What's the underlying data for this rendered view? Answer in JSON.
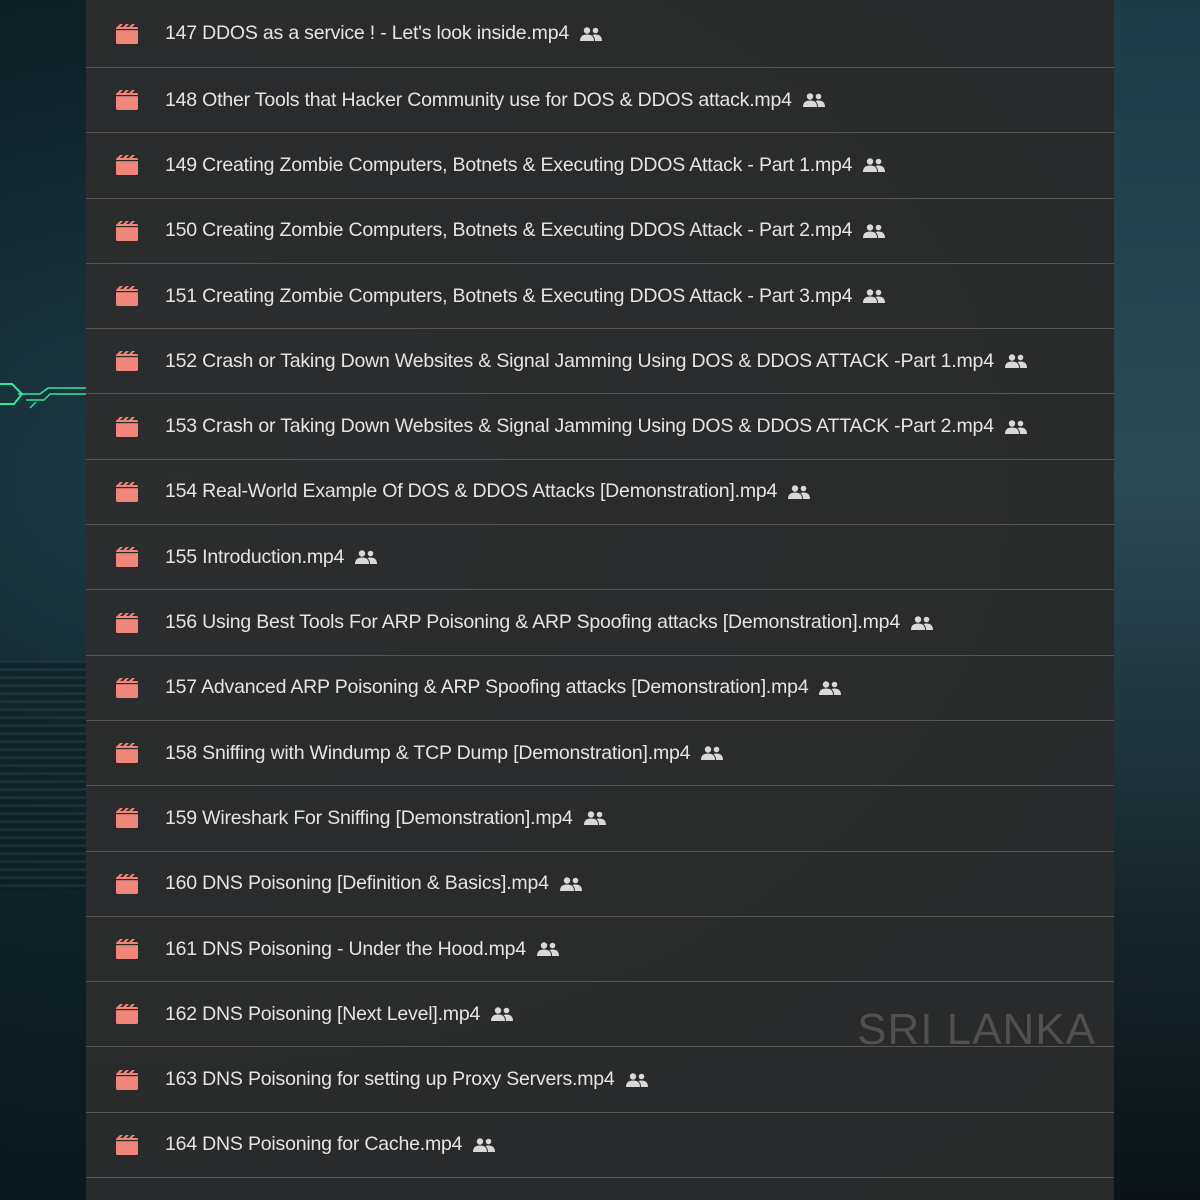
{
  "colors": {
    "row_background": "#2c2c2c",
    "text": "#e4e4e4",
    "file_icon": "#f0857a",
    "shared_icon": "#d8d8d8",
    "divider": "#787878"
  },
  "watermark": "SRI LANKA",
  "files": [
    {
      "name": "147 DDOS as a service ! - Let's look inside.mp4",
      "icon": "video-file-icon",
      "shared": "people-icon"
    },
    {
      "name": "148 Other Tools that Hacker Community use for DOS & DDOS attack.mp4",
      "icon": "video-file-icon",
      "shared": "people-icon"
    },
    {
      "name": "149 Creating Zombie Computers, Botnets & Executing DDOS Attack - Part 1.mp4",
      "icon": "video-file-icon",
      "shared": "people-icon"
    },
    {
      "name": "150 Creating Zombie Computers, Botnets & Executing DDOS Attack - Part 2.mp4",
      "icon": "video-file-icon",
      "shared": "people-icon"
    },
    {
      "name": "151 Creating Zombie Computers, Botnets & Executing DDOS Attack - Part 3.mp4",
      "icon": "video-file-icon",
      "shared": "people-icon"
    },
    {
      "name": "152 Crash or Taking Down Websites & Signal Jamming Using DOS & DDOS ATTACK -Part 1.mp4",
      "icon": "video-file-icon",
      "shared": "people-icon"
    },
    {
      "name": "153 Crash or Taking Down Websites & Signal Jamming Using DOS & DDOS ATTACK -Part 2.mp4",
      "icon": "video-file-icon",
      "shared": "people-icon"
    },
    {
      "name": "154 Real-World Example Of DOS & DDOS Attacks [Demonstration].mp4",
      "icon": "video-file-icon",
      "shared": "people-icon"
    },
    {
      "name": "155 Introduction.mp4",
      "icon": "video-file-icon",
      "shared": "people-icon"
    },
    {
      "name": "156 Using Best Tools For ARP Poisoning & ARP Spoofing attacks [Demonstration].mp4",
      "icon": "video-file-icon",
      "shared": "people-icon"
    },
    {
      "name": "157 Advanced ARP Poisoning & ARP Spoofing attacks [Demonstration].mp4",
      "icon": "video-file-icon",
      "shared": "people-icon"
    },
    {
      "name": "158 Sniffing with Windump & TCP Dump [Demonstration].mp4",
      "icon": "video-file-icon",
      "shared": "people-icon"
    },
    {
      "name": "159 Wireshark For Sniffing [Demonstration].mp4",
      "icon": "video-file-icon",
      "shared": "people-icon"
    },
    {
      "name": "160 DNS Poisoning [Definition & Basics].mp4",
      "icon": "video-file-icon",
      "shared": "people-icon"
    },
    {
      "name": "161 DNS Poisoning - Under the Hood.mp4",
      "icon": "video-file-icon",
      "shared": "people-icon"
    },
    {
      "name": "162 DNS Poisoning [Next Level].mp4",
      "icon": "video-file-icon",
      "shared": "people-icon"
    },
    {
      "name": "163 DNS Poisoning for setting up Proxy Servers.mp4",
      "icon": "video-file-icon",
      "shared": "people-icon"
    },
    {
      "name": "164 DNS Poisoning for Cache.mp4",
      "icon": "video-file-icon",
      "shared": "people-icon"
    }
  ]
}
